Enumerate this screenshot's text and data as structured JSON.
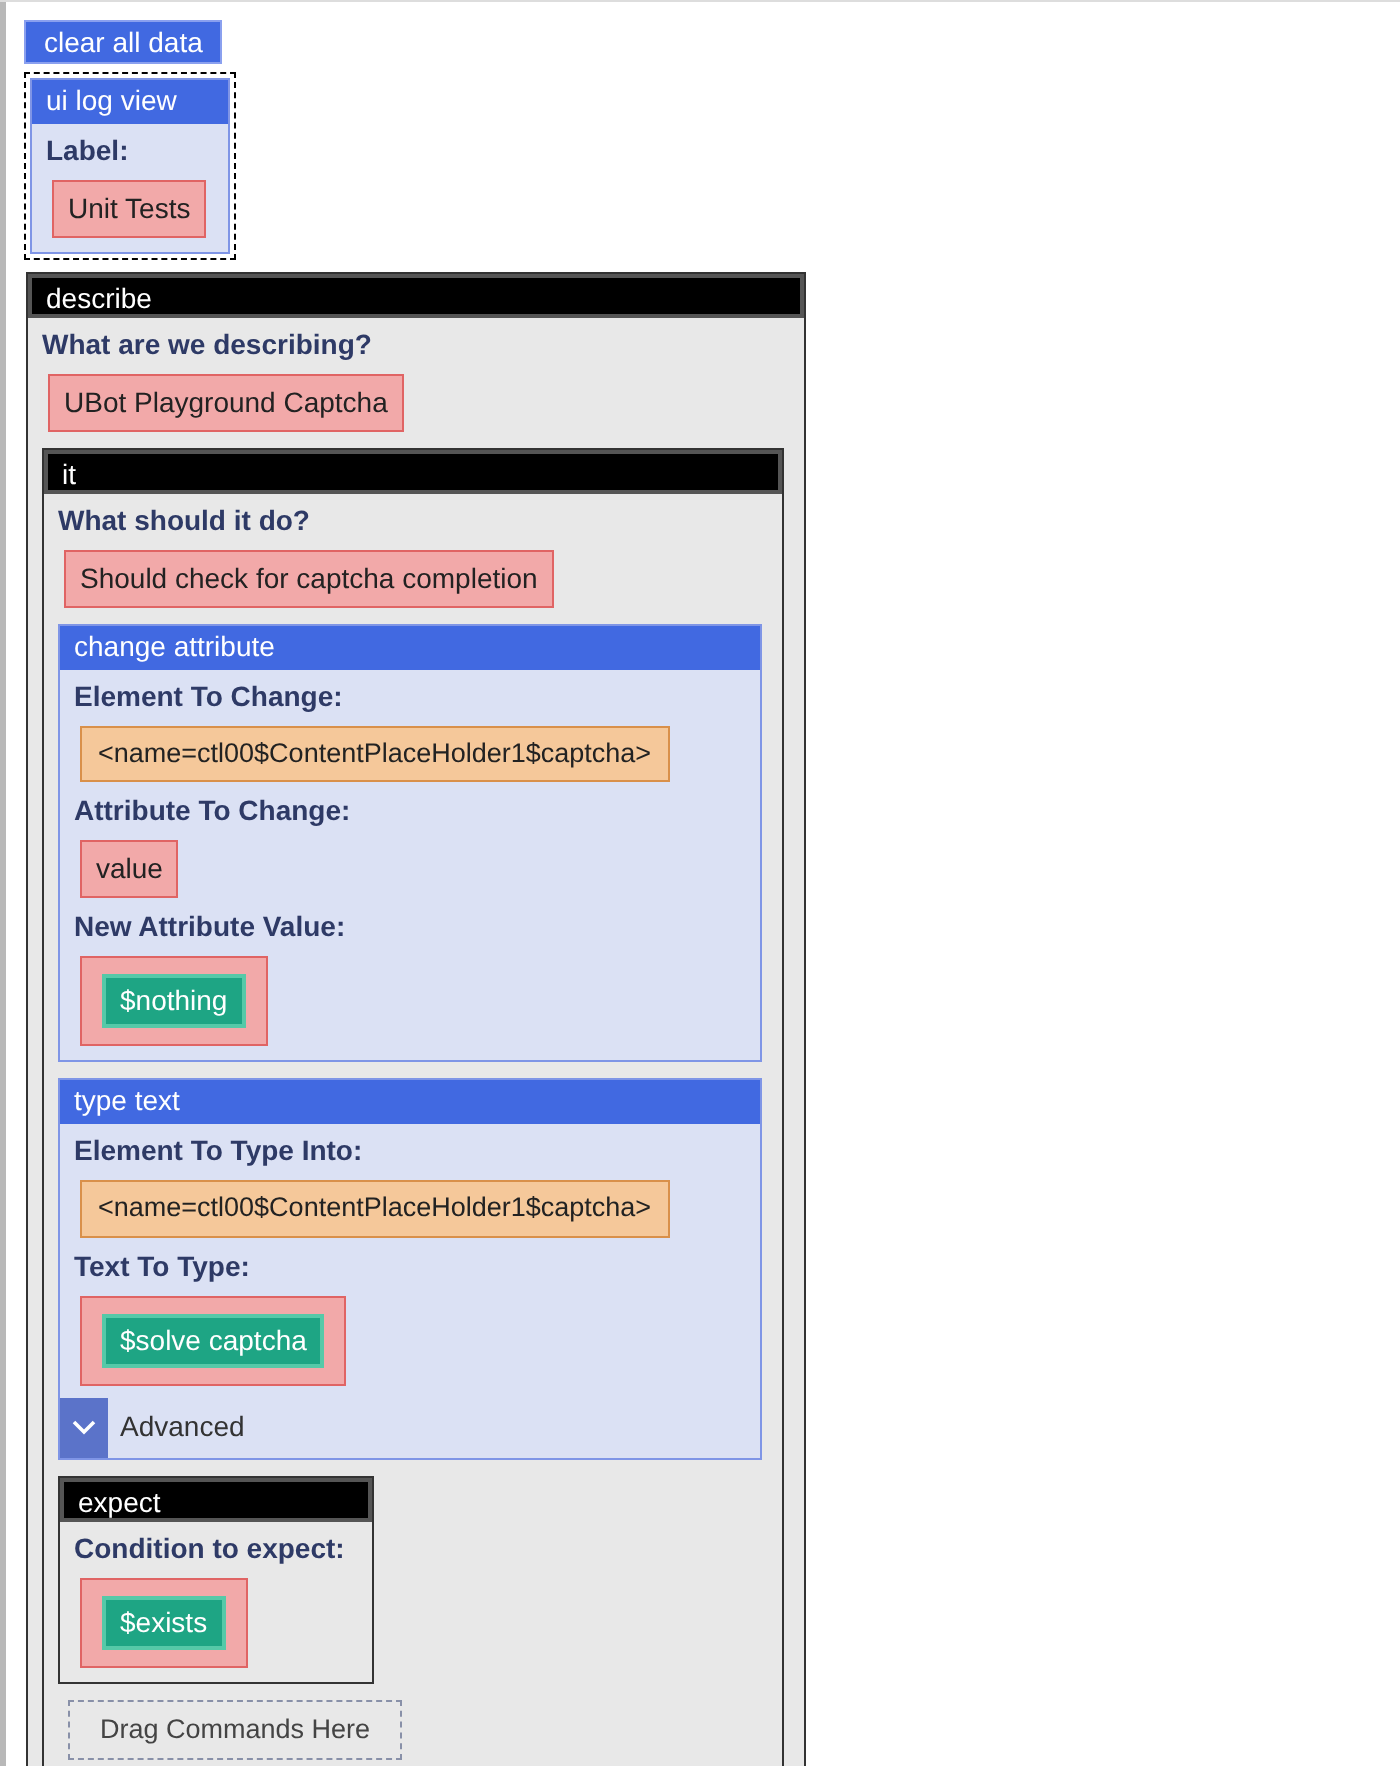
{
  "clear_button": "clear all data",
  "log_view": {
    "kind": "command",
    "title": "ui log view",
    "selected": true,
    "fields": [
      {
        "label": "Label:",
        "value": {
          "kind": "text",
          "text": "Unit Tests"
        }
      }
    ]
  },
  "root_block": {
    "kind": "container",
    "title": "describe",
    "fields": [
      {
        "label": "What are we describing?",
        "value": {
          "kind": "text",
          "text": "UBot Playground Captcha"
        }
      }
    ],
    "children": [
      {
        "kind": "container",
        "title": "it",
        "fields": [
          {
            "label": "What should it do?",
            "value": {
              "kind": "text",
              "text": "Should check for captcha completion"
            }
          }
        ],
        "children": [
          {
            "kind": "command",
            "title": "change attribute",
            "fields": [
              {
                "label": "Element To Change:",
                "value": {
                  "kind": "element",
                  "text": "<name=ctl00$ContentPlaceHolder1$captcha>"
                }
              },
              {
                "label": "Attribute To Change:",
                "value": {
                  "kind": "text",
                  "text": "value"
                }
              },
              {
                "label": "New Attribute Value:",
                "value": {
                  "kind": "variable",
                  "text": "$nothing"
                }
              }
            ]
          },
          {
            "kind": "command",
            "title": "type text",
            "fields": [
              {
                "label": "Element To Type Into:",
                "value": {
                  "kind": "element",
                  "text": "<name=ctl00$ContentPlaceHolder1$captcha>"
                }
              },
              {
                "label": "Text To Type:",
                "value": {
                  "kind": "variable",
                  "text": "$solve captcha"
                }
              }
            ],
            "advanced": {
              "label": "Advanced",
              "expanded": false
            }
          },
          {
            "kind": "container",
            "title": "expect",
            "narrow": true,
            "fields": [
              {
                "label": "Condition to expect:",
                "value": {
                  "kind": "variable",
                  "text": "$exists"
                }
              }
            ]
          }
        ],
        "drop_zone": "Drag Commands Here"
      }
    ]
  }
}
